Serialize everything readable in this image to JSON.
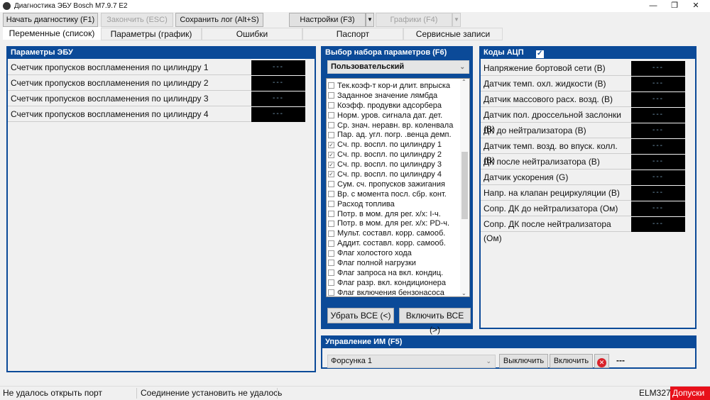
{
  "window": {
    "title": "Диагностика ЭБУ Bosch M7.9.7 E2"
  },
  "toolbar": {
    "start": "Начать диагностику (F1)",
    "stop": "Закончить (ESC)",
    "save_log": "Сохранить лог (Alt+S)",
    "settings": "Настройки (F3)",
    "charts": "Графики (F4)"
  },
  "tabs": [
    "Переменные (список)",
    "Параметры (график)",
    "Ошибки",
    "Паспорт",
    "Сервисные записи"
  ],
  "ecu_params": {
    "title": "Параметры ЭБУ",
    "rows": [
      {
        "label": "Счетчик пропусков воспламенения по цилиндру 1",
        "value": "---"
      },
      {
        "label": "Счетчик пропусков воспламенения по цилиндру 2",
        "value": "---"
      },
      {
        "label": "Счетчик пропусков воспламенения по цилиндру 3",
        "value": "---"
      },
      {
        "label": "Счетчик пропусков воспламенения по цилиндру 4",
        "value": "---"
      }
    ]
  },
  "param_set": {
    "title": "Выбор набора параметров (F6)",
    "selected": "Пользовательский",
    "items": [
      {
        "label": "Тек.коэф-т кор-и длит. впрыска",
        "checked": false
      },
      {
        "label": "Заданное значение лямбда",
        "checked": false
      },
      {
        "label": "Коэфф. продувки адсорбера",
        "checked": false
      },
      {
        "label": "Норм. уров. сигнала дат. дет.",
        "checked": false
      },
      {
        "label": "Ср. знач. неравн. вр. коленвала",
        "checked": false
      },
      {
        "label": "Пар. ад. угл. погр. .венца демп.",
        "checked": false
      },
      {
        "label": "Сч. пр. воспл. по цилиндру 1",
        "checked": true
      },
      {
        "label": "Сч. пр. воспл. по цилиндру 2",
        "checked": true
      },
      {
        "label": "Сч. пр. воспл. по цилиндру 3",
        "checked": true
      },
      {
        "label": "Сч. пр. воспл. по цилиндру 4",
        "checked": true
      },
      {
        "label": "Сум. сч. пропусков зажигания",
        "checked": false
      },
      {
        "label": "Вр. с момента посл. сбр. конт.",
        "checked": false
      },
      {
        "label": "Расход топлива",
        "checked": false
      },
      {
        "label": "Потр. в мом. для рег. х/х: I-ч.",
        "checked": false
      },
      {
        "label": "Потр. в мом. для рег. х/х: PD-ч.",
        "checked": false
      },
      {
        "label": "Мульт. составл. корр. самооб.",
        "checked": false
      },
      {
        "label": "Аддит. составл. корр. самооб.",
        "checked": false
      },
      {
        "label": "Флаг холостого хода",
        "checked": false
      },
      {
        "label": "Флаг полной нагрузки",
        "checked": false
      },
      {
        "label": "Флаг запроса на вкл. кондиц.",
        "checked": false
      },
      {
        "label": "Флаг разр. вкл. кондиционера",
        "checked": false
      },
      {
        "label": "Флаг включения бензонасоса",
        "checked": false
      }
    ],
    "remove_all": "Убрать ВСЕ (<)",
    "add_all": "Включить ВСЕ (>)"
  },
  "adc": {
    "title": "Коды АЦП",
    "checked": true,
    "rows": [
      {
        "label": "Напряжение бортовой сети (В)",
        "value": "---"
      },
      {
        "label": "Датчик темп. охл. жидкости (В)",
        "value": "---"
      },
      {
        "label": "Датчик массового расх. возд. (В)",
        "value": "---"
      },
      {
        "label": "Датчик пол. дроссельной заслонки (В)",
        "value": "---"
      },
      {
        "label": "ДК до нейтрализатора (В)",
        "value": "---"
      },
      {
        "label": "Датчик темп. возд. во впуск. колл. (В)",
        "value": "---"
      },
      {
        "label": "ДК после нейтрализатора (В)",
        "value": "---"
      },
      {
        "label": "Датчик ускорения (G)",
        "value": "---"
      },
      {
        "label": "Напр. на клапан рециркуляции (В)",
        "value": "---"
      },
      {
        "label": "Сопр. ДК до нейтрализатора (Ом)",
        "value": "---"
      },
      {
        "label": "Сопр. ДК после нейтрализатора (Ом)",
        "value": "---"
      }
    ]
  },
  "actuators": {
    "title": "Управление ИМ (F5)",
    "selected": "Форсунка 1",
    "off": "Выключить",
    "on": "Включить",
    "state": "---"
  },
  "status": {
    "port": "Не удалось открыть порт",
    "connection": "Соединение установить не удалось",
    "adapter": "ELM327",
    "tolerances": "Допуски"
  }
}
